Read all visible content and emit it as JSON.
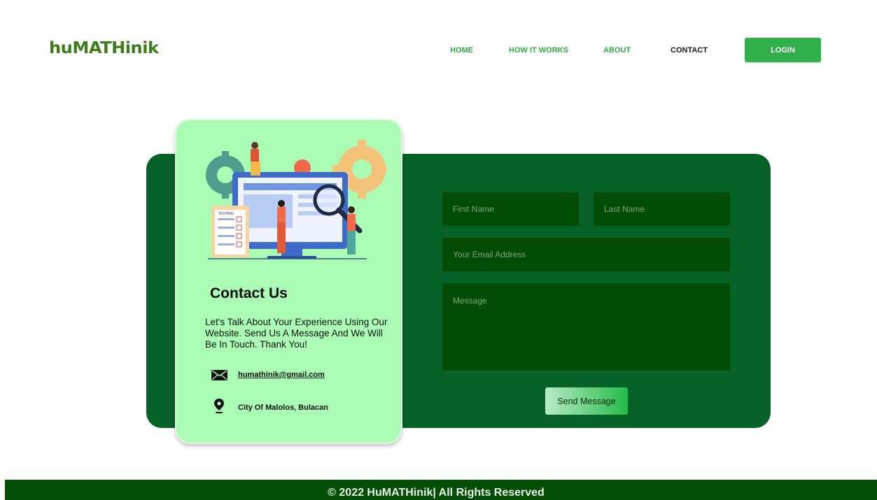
{
  "header": {
    "logo": "huMATHinik",
    "nav": [
      {
        "label": "HOME",
        "active": false
      },
      {
        "label": "HOW IT WORKS",
        "active": false
      },
      {
        "label": "ABOUT",
        "active": false
      },
      {
        "label": "CONTACT",
        "active": true
      }
    ],
    "login_label": "LOGIN"
  },
  "contact_card": {
    "illustration_label": "TESTING",
    "title": "Contact Us",
    "description": "Let's Talk About Your Experience Using Our Website. Send Us A Message And We Will Be In Touch. Thank You!",
    "email": "humathinik@gmail.com",
    "location": "City Of Malolos, Bulacan",
    "icons": [
      "mail-icon",
      "location-pin-icon"
    ]
  },
  "form": {
    "first_name": {
      "value": "",
      "placeholder": "First Name"
    },
    "last_name": {
      "value": "",
      "placeholder": "Last Name"
    },
    "email": {
      "value": "",
      "placeholder": "Your Email Address"
    },
    "message": {
      "value": "",
      "placeholder": "Message"
    },
    "send_label": "Send Message"
  },
  "footer": {
    "text": "© 2022 HuMATHinik| All Rights Reserved"
  },
  "colors": {
    "brand_green": "#2fb04a",
    "logo_green": "#3f7d1c",
    "panel_dark": "#076227",
    "field_dark": "#024c06",
    "card_light": "#aafbb4",
    "footer": "#034f05"
  }
}
